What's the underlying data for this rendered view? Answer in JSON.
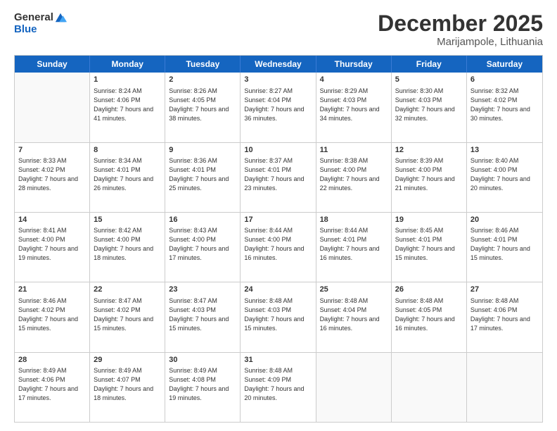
{
  "header": {
    "logo_general": "General",
    "logo_blue": "Blue",
    "month": "December 2025",
    "location": "Marijampole, Lithuania"
  },
  "days_of_week": [
    "Sunday",
    "Monday",
    "Tuesday",
    "Wednesday",
    "Thursday",
    "Friday",
    "Saturday"
  ],
  "rows": [
    [
      {
        "day": "",
        "empty": true
      },
      {
        "day": "1",
        "sunrise": "8:24 AM",
        "sunset": "4:06 PM",
        "daylight": "7 hours and 41 minutes."
      },
      {
        "day": "2",
        "sunrise": "8:26 AM",
        "sunset": "4:05 PM",
        "daylight": "7 hours and 38 minutes."
      },
      {
        "day": "3",
        "sunrise": "8:27 AM",
        "sunset": "4:04 PM",
        "daylight": "7 hours and 36 minutes."
      },
      {
        "day": "4",
        "sunrise": "8:29 AM",
        "sunset": "4:03 PM",
        "daylight": "7 hours and 34 minutes."
      },
      {
        "day": "5",
        "sunrise": "8:30 AM",
        "sunset": "4:03 PM",
        "daylight": "7 hours and 32 minutes."
      },
      {
        "day": "6",
        "sunrise": "8:32 AM",
        "sunset": "4:02 PM",
        "daylight": "7 hours and 30 minutes."
      }
    ],
    [
      {
        "day": "7",
        "sunrise": "8:33 AM",
        "sunset": "4:02 PM",
        "daylight": "7 hours and 28 minutes."
      },
      {
        "day": "8",
        "sunrise": "8:34 AM",
        "sunset": "4:01 PM",
        "daylight": "7 hours and 26 minutes."
      },
      {
        "day": "9",
        "sunrise": "8:36 AM",
        "sunset": "4:01 PM",
        "daylight": "7 hours and 25 minutes."
      },
      {
        "day": "10",
        "sunrise": "8:37 AM",
        "sunset": "4:01 PM",
        "daylight": "7 hours and 23 minutes."
      },
      {
        "day": "11",
        "sunrise": "8:38 AM",
        "sunset": "4:00 PM",
        "daylight": "7 hours and 22 minutes."
      },
      {
        "day": "12",
        "sunrise": "8:39 AM",
        "sunset": "4:00 PM",
        "daylight": "7 hours and 21 minutes."
      },
      {
        "day": "13",
        "sunrise": "8:40 AM",
        "sunset": "4:00 PM",
        "daylight": "7 hours and 20 minutes."
      }
    ],
    [
      {
        "day": "14",
        "sunrise": "8:41 AM",
        "sunset": "4:00 PM",
        "daylight": "7 hours and 19 minutes."
      },
      {
        "day": "15",
        "sunrise": "8:42 AM",
        "sunset": "4:00 PM",
        "daylight": "7 hours and 18 minutes."
      },
      {
        "day": "16",
        "sunrise": "8:43 AM",
        "sunset": "4:00 PM",
        "daylight": "7 hours and 17 minutes."
      },
      {
        "day": "17",
        "sunrise": "8:44 AM",
        "sunset": "4:00 PM",
        "daylight": "7 hours and 16 minutes."
      },
      {
        "day": "18",
        "sunrise": "8:44 AM",
        "sunset": "4:01 PM",
        "daylight": "7 hours and 16 minutes."
      },
      {
        "day": "19",
        "sunrise": "8:45 AM",
        "sunset": "4:01 PM",
        "daylight": "7 hours and 15 minutes."
      },
      {
        "day": "20",
        "sunrise": "8:46 AM",
        "sunset": "4:01 PM",
        "daylight": "7 hours and 15 minutes."
      }
    ],
    [
      {
        "day": "21",
        "sunrise": "8:46 AM",
        "sunset": "4:02 PM",
        "daylight": "7 hours and 15 minutes."
      },
      {
        "day": "22",
        "sunrise": "8:47 AM",
        "sunset": "4:02 PM",
        "daylight": "7 hours and 15 minutes."
      },
      {
        "day": "23",
        "sunrise": "8:47 AM",
        "sunset": "4:03 PM",
        "daylight": "7 hours and 15 minutes."
      },
      {
        "day": "24",
        "sunrise": "8:48 AM",
        "sunset": "4:03 PM",
        "daylight": "7 hours and 15 minutes."
      },
      {
        "day": "25",
        "sunrise": "8:48 AM",
        "sunset": "4:04 PM",
        "daylight": "7 hours and 16 minutes."
      },
      {
        "day": "26",
        "sunrise": "8:48 AM",
        "sunset": "4:05 PM",
        "daylight": "7 hours and 16 minutes."
      },
      {
        "day": "27",
        "sunrise": "8:48 AM",
        "sunset": "4:06 PM",
        "daylight": "7 hours and 17 minutes."
      }
    ],
    [
      {
        "day": "28",
        "sunrise": "8:49 AM",
        "sunset": "4:06 PM",
        "daylight": "7 hours and 17 minutes."
      },
      {
        "day": "29",
        "sunrise": "8:49 AM",
        "sunset": "4:07 PM",
        "daylight": "7 hours and 18 minutes."
      },
      {
        "day": "30",
        "sunrise": "8:49 AM",
        "sunset": "4:08 PM",
        "daylight": "7 hours and 19 minutes."
      },
      {
        "day": "31",
        "sunrise": "8:48 AM",
        "sunset": "4:09 PM",
        "daylight": "7 hours and 20 minutes."
      },
      {
        "day": "",
        "empty": true
      },
      {
        "day": "",
        "empty": true
      },
      {
        "day": "",
        "empty": true
      }
    ]
  ]
}
